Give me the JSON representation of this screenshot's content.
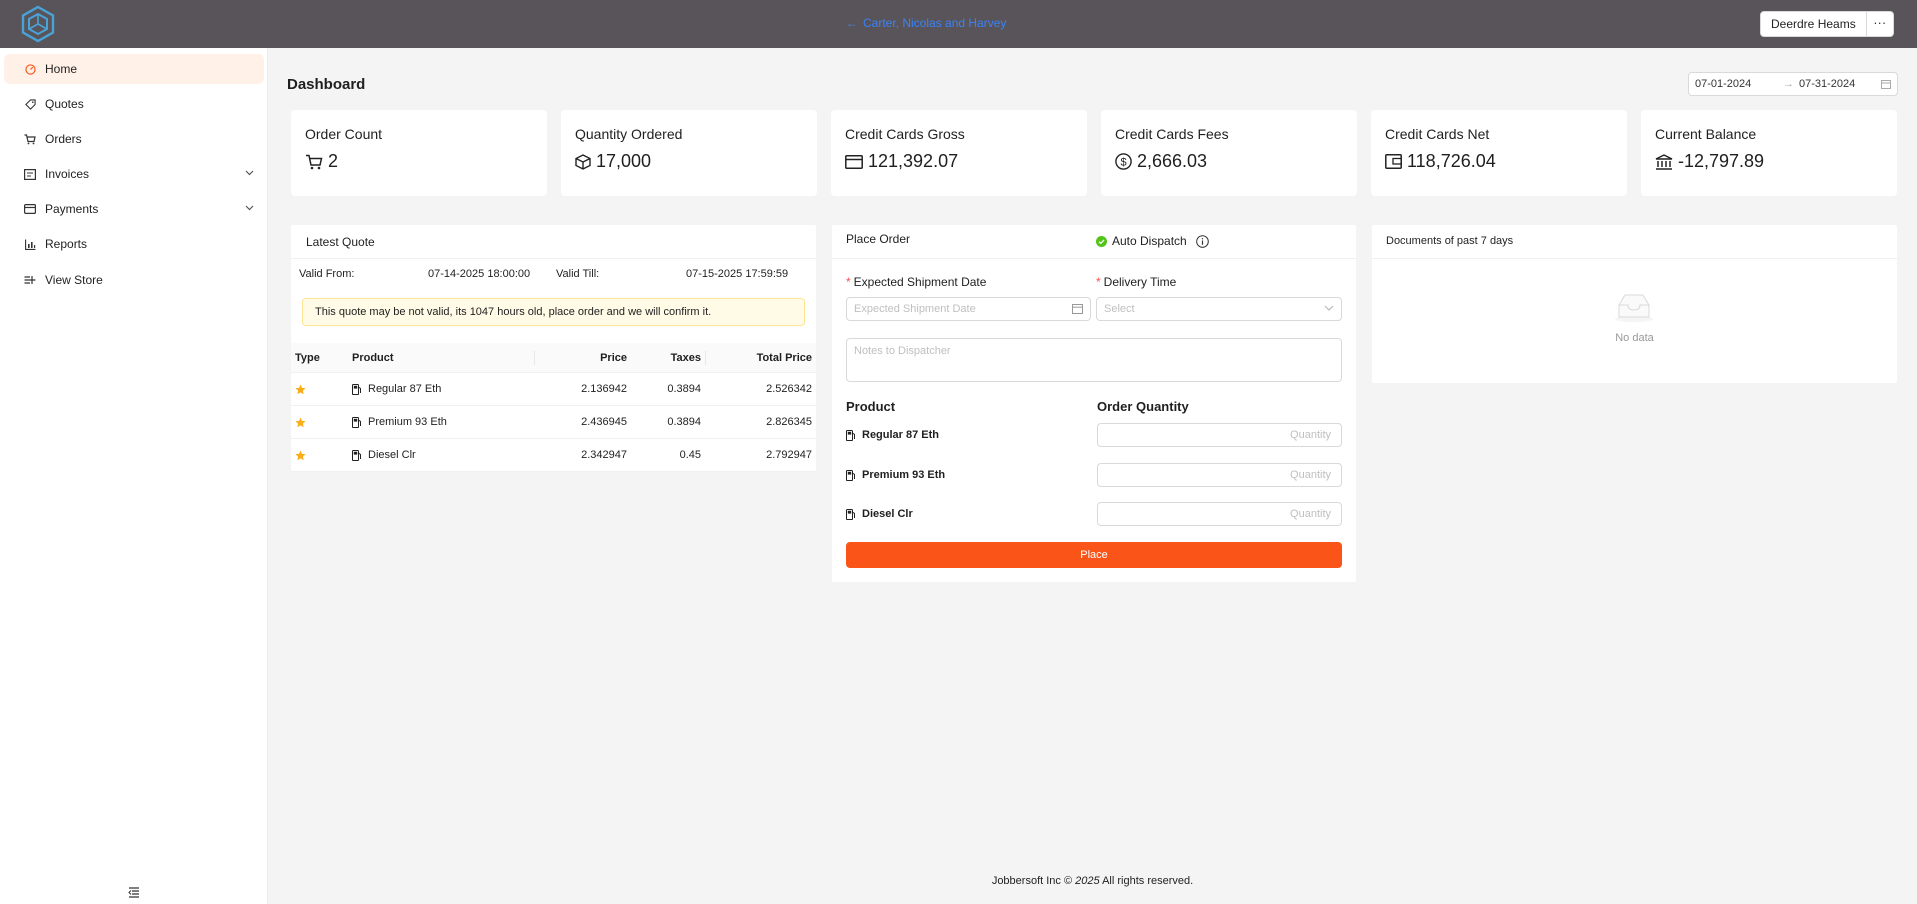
{
  "header": {
    "back_link": "Carter, Nicolas and Harvey",
    "user_name": "Deerdre Heams",
    "more": "···"
  },
  "sidebar": {
    "items": [
      {
        "label": "Home",
        "icon": "dashboard-icon",
        "active": true
      },
      {
        "label": "Quotes",
        "icon": "tag-icon"
      },
      {
        "label": "Orders",
        "icon": "cart-icon"
      },
      {
        "label": "Invoices",
        "icon": "invoice-icon",
        "expandable": true
      },
      {
        "label": "Payments",
        "icon": "payment-icon",
        "expandable": true
      },
      {
        "label": "Reports",
        "icon": "bar-chart-icon"
      },
      {
        "label": "View Store",
        "icon": "store-icon"
      }
    ]
  },
  "page": {
    "title": "Dashboard",
    "date_from": "07-01-2024",
    "date_to": "07-31-2024"
  },
  "stats": [
    {
      "label": "Order Count",
      "value": "2",
      "icon": "cart-icon"
    },
    {
      "label": "Quantity Ordered",
      "value": "17,000",
      "icon": "box-icon"
    },
    {
      "label": "Credit Cards Gross",
      "value": "121,392.07",
      "icon": "credit-card-icon"
    },
    {
      "label": "Credit Cards Fees",
      "value": "2,666.03",
      "icon": "dollar-circle-icon"
    },
    {
      "label": "Credit Cards Net",
      "value": "118,726.04",
      "icon": "wallet-icon"
    },
    {
      "label": "Current Balance",
      "value": "-12,797.89",
      "icon": "bank-icon"
    }
  ],
  "quote": {
    "title": "Latest Quote",
    "valid_from_label": "Valid From:",
    "valid_from": "07-14-2025 18:00:00",
    "valid_till_label": "Valid Till:",
    "valid_till": "07-15-2025 17:59:59",
    "warning": "This quote may be not valid, its 1047 hours old, place order and we will confirm it.",
    "columns": [
      "Type",
      "Product",
      "Price",
      "Taxes",
      "Total Price"
    ],
    "rows": [
      {
        "product": "Regular 87 Eth",
        "price": "2.136942",
        "taxes": "0.3894",
        "total": "2.526342"
      },
      {
        "product": "Premium 93 Eth",
        "price": "2.436945",
        "taxes": "0.3894",
        "total": "2.826345"
      },
      {
        "product": "Diesel Clr",
        "price": "2.342947",
        "taxes": "0.45",
        "total": "2.792947"
      }
    ]
  },
  "order": {
    "title": "Place Order",
    "auto_dispatch": "Auto Dispatch",
    "shipment_label": "Expected Shipment Date",
    "shipment_placeholder": "Expected Shipment Date",
    "delivery_label": "Delivery Time",
    "delivery_placeholder": "Select",
    "notes_placeholder": "Notes to Dispatcher",
    "product_col": "Product",
    "qty_col": "Order Quantity",
    "qty_placeholder": "Quantity",
    "products": [
      "Regular 87 Eth",
      "Premium 93 Eth",
      "Diesel Clr"
    ],
    "place_button": "Place"
  },
  "documents": {
    "title": "Documents of past 7 days",
    "empty": "No data"
  },
  "footer": {
    "company": "Jobbersoft Inc ©",
    "year": "2025",
    "rights": "All rights reserved."
  },
  "colors": {
    "accent": "#fa5418",
    "topbar": "#58545a",
    "link": "#3b82f6",
    "star": "#faad14",
    "success": "#52c41a"
  }
}
